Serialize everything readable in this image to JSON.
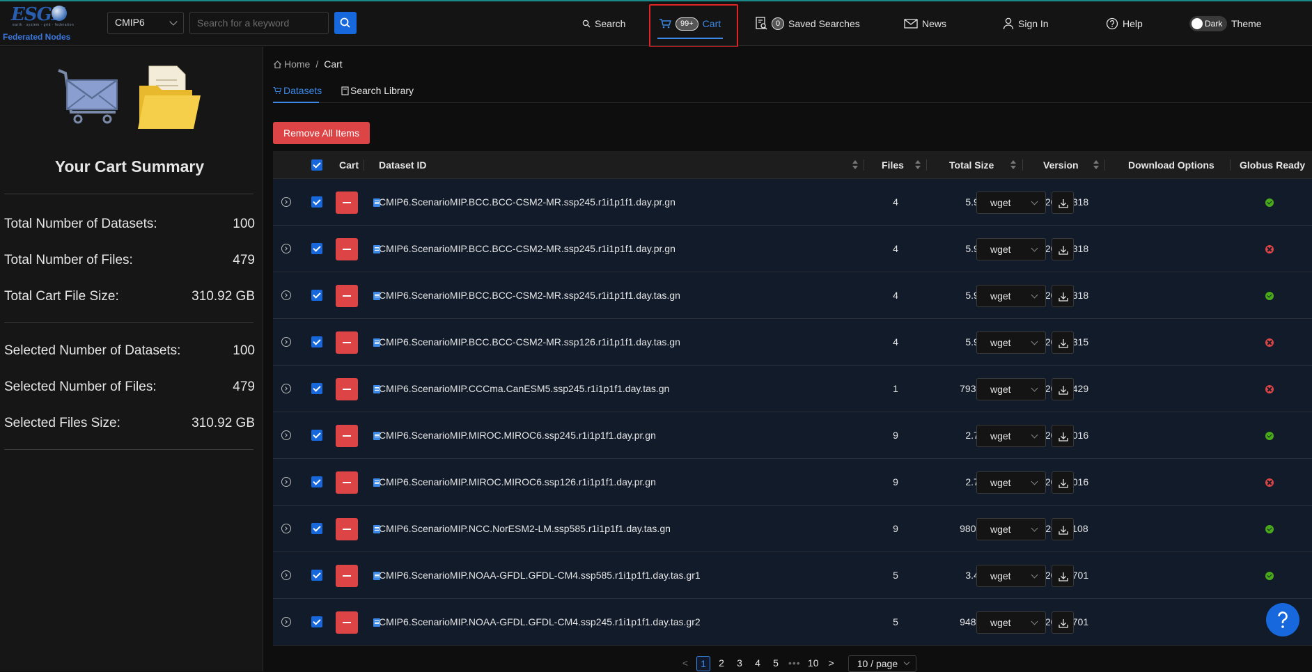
{
  "logo": {
    "text": "ESGF",
    "tagline": "earth · system · grid · federation",
    "subtitle": "Federated Nodes"
  },
  "header": {
    "project_select": "CMIP6",
    "search_placeholder": "Search for a keyword",
    "nav": {
      "search": "Search",
      "cart_badge": "99+",
      "cart": "Cart",
      "saved_badge": "0",
      "saved": "Saved Searches",
      "news": "News",
      "signin": "Sign In",
      "help": "Help",
      "theme_toggle": "Dark",
      "theme": "Theme"
    }
  },
  "sidebar": {
    "title": "Your Cart Summary",
    "totals": [
      {
        "label": "Total Number of Datasets:",
        "value": "100"
      },
      {
        "label": "Total Number of Files:",
        "value": "479"
      },
      {
        "label": "Total Cart File Size:",
        "value": "310.92 GB"
      }
    ],
    "selected": [
      {
        "label": "Selected Number of Datasets:",
        "value": "100"
      },
      {
        "label": "Selected Number of Files:",
        "value": "479"
      },
      {
        "label": "Selected Files Size:",
        "value": "310.92 GB"
      }
    ]
  },
  "breadcrumb": {
    "home": "Home",
    "sep": "/",
    "current": "Cart"
  },
  "tabs": {
    "datasets": "Datasets",
    "library": "Search Library"
  },
  "remove_all": "Remove All Items",
  "table": {
    "headers": {
      "cart": "Cart",
      "dataset_id": "Dataset ID",
      "files": "Files",
      "total_size": "Total Size",
      "version": "Version",
      "download": "Download Options",
      "globus": "Globus Ready"
    },
    "rows": [
      {
        "id": "CMIP6.ScenarioMIP.BCC.BCC-CSM2-MR.ssp245.r1i1p1f1.day.pr.gn",
        "files": "4",
        "size": "5.99 GB",
        "version": "20190318",
        "download": "wget",
        "globus": "ready"
      },
      {
        "id": "CMIP6.ScenarioMIP.BCC.BCC-CSM2-MR.ssp245.r1i1p1f1.day.pr.gn",
        "files": "4",
        "size": "5.99 GB",
        "version": "20190318",
        "download": "wget",
        "globus": "not-ready"
      },
      {
        "id": "CMIP6.ScenarioMIP.BCC.BCC-CSM2-MR.ssp245.r1i1p1f1.day.tas.gn",
        "files": "4",
        "size": "5.99 GB",
        "version": "20190318",
        "download": "wget",
        "globus": "ready"
      },
      {
        "id": "CMIP6.ScenarioMIP.BCC.BCC-CSM2-MR.ssp126.r1i1p1f1.day.tas.gn",
        "files": "4",
        "size": "5.99 GB",
        "version": "20190315",
        "download": "wget",
        "globus": "not-ready"
      },
      {
        "id": "CMIP6.ScenarioMIP.CCCma.CanESM5.ssp245.r1i1p1f1.day.tas.gn",
        "files": "1",
        "size": "793.39 MB",
        "version": "20190429",
        "download": "wget",
        "globus": "not-ready"
      },
      {
        "id": "CMIP6.ScenarioMIP.MIROC.MIROC6.ssp245.r1i1p1f1.day.pr.gn",
        "files": "9",
        "size": "2.74 GB",
        "version": "20191016",
        "download": "wget",
        "globus": "ready"
      },
      {
        "id": "CMIP6.ScenarioMIP.MIROC.MIROC6.ssp126.r1i1p1f1.day.pr.gn",
        "files": "9",
        "size": "2.74 GB",
        "version": "20191016",
        "download": "wget",
        "globus": "not-ready"
      },
      {
        "id": "CMIP6.ScenarioMIP.NCC.NorESM2-LM.ssp585.r1i1p1f1.day.tas.gn",
        "files": "9",
        "size": "980.84 MB",
        "version": "20191108",
        "download": "wget",
        "globus": "ready"
      },
      {
        "id": "CMIP6.ScenarioMIP.NOAA-GFDL.GFDL-CM4.ssp585.r1i1p1f1.day.tas.gr1",
        "files": "5",
        "size": "3.46 GB",
        "version": "20180701",
        "download": "wget",
        "globus": "ready"
      },
      {
        "id": "CMIP6.ScenarioMIP.NOAA-GFDL.GFDL-CM4.ssp245.r1i1p1f1.day.tas.gr2",
        "files": "5",
        "size": "948.08 MB",
        "version": "20180701",
        "download": "wget",
        "globus": "hidden"
      }
    ]
  },
  "pagination": {
    "prev": "<",
    "pages": [
      "1",
      "2",
      "3",
      "4",
      "5"
    ],
    "ellipsis": "•••",
    "last": "10",
    "next": ">",
    "page_size": "10 / page",
    "active": "1"
  },
  "colors": {
    "accent": "#3c89e8",
    "danger": "#dc4446",
    "success": "#49aa19",
    "row_bg": "#121b2a"
  }
}
